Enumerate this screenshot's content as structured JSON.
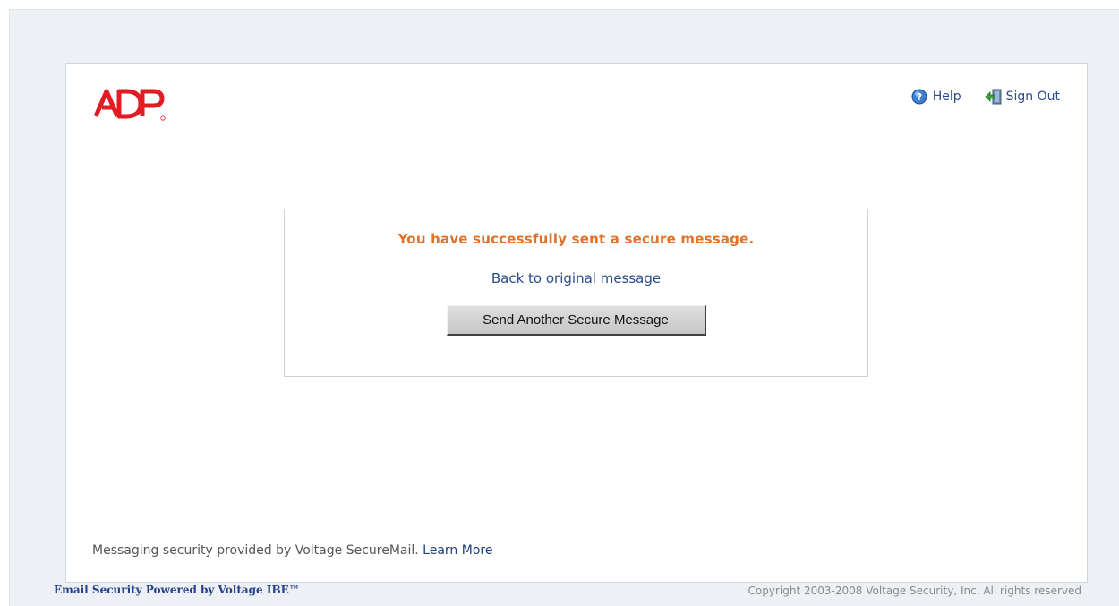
{
  "brand": {
    "logo_text": "ADP",
    "logo_color": "#e31c23"
  },
  "header": {
    "help_label": "Help",
    "signout_label": "Sign Out"
  },
  "message": {
    "success_text": "You have successfully sent a secure message.",
    "back_link": "Back to original message",
    "send_another_button": "Send Another Secure Message"
  },
  "footer": {
    "note_text": "Messaging security provided by Voltage SecureMail.",
    "learn_more_link": "Learn More",
    "powered_by": "Email Security Powered by Voltage IBE™",
    "copyright": "Copyright 2003-2008 Voltage Security, Inc. All rights reserved"
  },
  "colors": {
    "accent_orange": "#e0722a",
    "link_blue": "#2a4b8d",
    "page_bg": "#edf0f5"
  },
  "icons": {
    "help": "help-icon",
    "signout": "sign-out-icon"
  }
}
